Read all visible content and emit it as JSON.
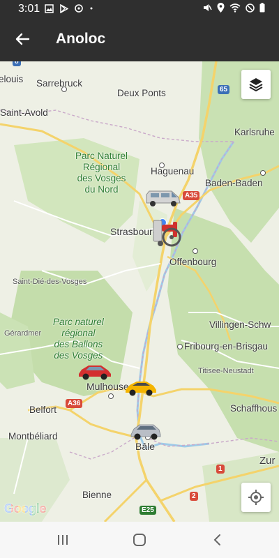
{
  "status_bar": {
    "time": "3:01",
    "left_icons": [
      "image-icon",
      "play-store-icon",
      "sync-icon",
      "dot-icon"
    ],
    "right_icons": [
      "mute-icon",
      "location-icon",
      "wifi-icon",
      "do-not-disturb-icon",
      "battery-icon"
    ]
  },
  "app_bar": {
    "title": "Anoloc",
    "back_icon": "arrow-left-icon"
  },
  "map": {
    "places": {
      "sarrelouis": "elouis",
      "sarrebruck": "Sarrebruck",
      "deux_ponts": "Deux Ponts",
      "saint_avold": "Saint-Avold",
      "karlsruhe": "Karlsruhe",
      "haguenau": "Haguenau",
      "baden_baden": "Baden-Baden",
      "strasbourg": "Strasbourg",
      "offenbourg": "Offenbourg",
      "saint_die": "Saint-Dié-des-Vosges",
      "gerardmer": "Gérardmer",
      "villingen": "Villingen-Schw",
      "fribourg": "Fribourg-en-Brisgau",
      "titisee": "Titisee-Neustadt",
      "mulhouse": "Mulhouse",
      "schaffhouse": "Schaffhous",
      "belfort": "Belfort",
      "montbeliard": "Montbéliard",
      "bale": "Bâle",
      "zurich": "Zur",
      "bienne": "Bienne"
    },
    "parks": {
      "vosges_nord": [
        "Parc Naturel",
        "Régional",
        "des Vosges",
        "du Nord"
      ],
      "ballons_vosges": [
        "Parc naturel",
        "régional",
        "des Ballons",
        "des Vosges"
      ]
    },
    "road_labels": {
      "r8": "8",
      "r65": "65",
      "a35": "A35",
      "a36": "A36",
      "r1": "1",
      "r2": "2",
      "e25": "E25"
    },
    "vehicles": [
      {
        "type": "van",
        "name": "van-vehicle-marker",
        "color": "#c8c8c8"
      },
      {
        "type": "wheelchair",
        "name": "wheelchair-vehicle-marker",
        "color": "#d0312d"
      },
      {
        "type": "car",
        "name": "red-car-vehicle-marker",
        "color": "#d32f2f"
      },
      {
        "type": "car",
        "name": "yellow-car-vehicle-marker",
        "color": "#f4b400"
      },
      {
        "type": "car",
        "name": "silver-car-vehicle-marker",
        "color": "#b9bec6"
      }
    ],
    "layers_icon": "layers-icon",
    "locate_icon": "my-location-icon",
    "attribution": "Google",
    "accent_blue": "#4285F4"
  },
  "nav_bar": {
    "recents_icon": "recents-icon",
    "home_icon": "home-icon",
    "back_icon": "nav-back-icon"
  }
}
